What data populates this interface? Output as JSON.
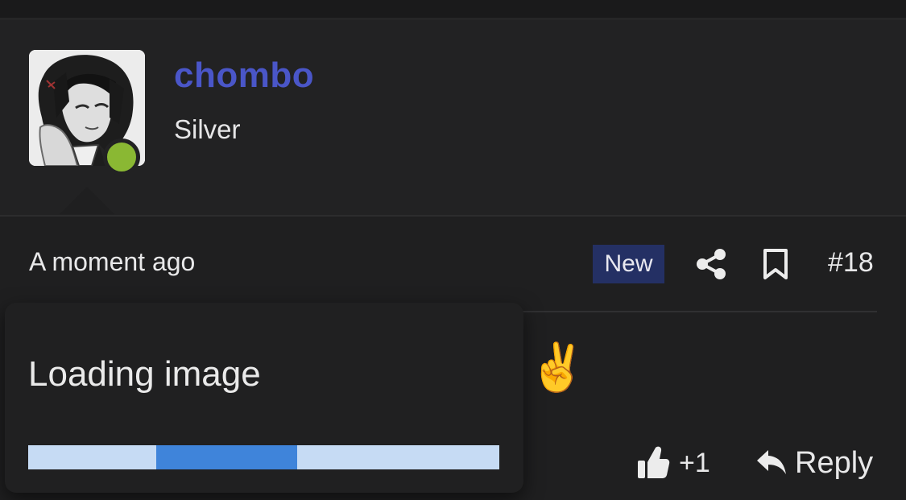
{
  "post": {
    "username": "chombo",
    "user_title": "Silver",
    "online_status": "online",
    "timestamp": "A moment ago",
    "badge": "New",
    "post_number": "#18",
    "content_emoji": "✌",
    "reactions": {
      "count": "+1",
      "reply_label": "Reply"
    }
  },
  "loading": {
    "text": "Loading image",
    "progress": {
      "fill_start": 0.272,
      "fill_end": 0.571
    }
  },
  "icons": {
    "share": "share-icon",
    "bookmark": "bookmark-icon",
    "like": "thumbs-up-icon",
    "reply": "reply-icon"
  },
  "colors": {
    "username": "#4a56c8",
    "online": "#8ab833",
    "badge_bg": "#243064",
    "progress_track": "#c6dbf4",
    "progress_fill": "#3f84da"
  }
}
